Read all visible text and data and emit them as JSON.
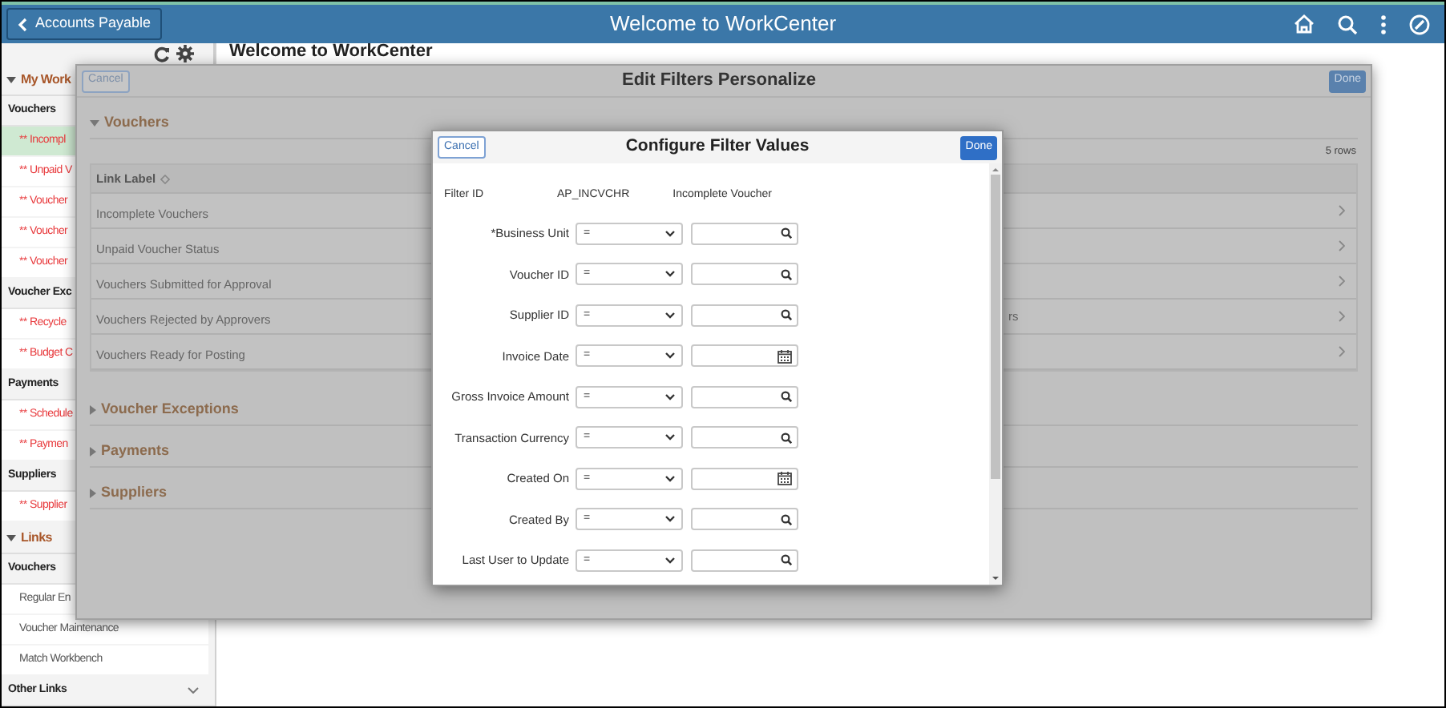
{
  "header": {
    "back_button": "Accounts Payable",
    "title": "Welcome to WorkCenter"
  },
  "sidebar": {
    "sections": [
      {
        "title": "My Work",
        "kind": "work",
        "expanded": true,
        "groups": [
          {
            "title": "Vouchers",
            "expanded": true,
            "items": [
              {
                "label": "** Incompl",
                "selected": true
              },
              {
                "label": "** Unpaid V",
                "selected": false
              },
              {
                "label": "** Voucher",
                "selected": false
              },
              {
                "label": "** Voucher",
                "selected": false
              },
              {
                "label": "** Voucher",
                "selected": false
              }
            ]
          },
          {
            "title": "Voucher Exc",
            "expanded": true,
            "items": [
              {
                "label": "** Recycle",
                "selected": false
              },
              {
                "label": "** Budget C",
                "selected": false
              }
            ]
          },
          {
            "title": "Payments",
            "expanded": true,
            "items": [
              {
                "label": "** Schedule",
                "selected": false
              },
              {
                "label": "** Paymen",
                "selected": false
              }
            ]
          },
          {
            "title": "Suppliers",
            "expanded": true,
            "items": [
              {
                "label": "** Supplier",
                "selected": false
              }
            ]
          }
        ]
      },
      {
        "title": "Links",
        "kind": "links",
        "expanded": true,
        "groups": [
          {
            "title": "Vouchers",
            "expanded": true,
            "items": [
              {
                "label": "Regular En",
                "selected": false
              },
              {
                "label": "Voucher Maintenance",
                "selected": false
              },
              {
                "label": "Match Workbench",
                "selected": false
              }
            ]
          },
          {
            "title": "Other Links",
            "expanded": false
          }
        ]
      }
    ]
  },
  "main": {
    "title": "Welcome to WorkCenter"
  },
  "edit_filters": {
    "title": "Edit Filters Personalize",
    "cancel": "Cancel",
    "done": "Done",
    "sections": [
      {
        "title": "Vouchers",
        "expanded": true,
        "row_count": "5 rows",
        "column_header": "Link Label",
        "rows": [
          {
            "label": "Incomplete Vouchers"
          },
          {
            "label": "Unpaid Voucher Status"
          },
          {
            "label": "Vouchers Submitted for Approval"
          },
          {
            "label": "Vouchers Rejected by Approvers",
            "column_2": "rs"
          },
          {
            "label": "Vouchers Ready for Posting"
          }
        ]
      },
      {
        "title": "Voucher Exceptions",
        "expanded": false
      },
      {
        "title": "Payments",
        "expanded": false
      },
      {
        "title": "Suppliers",
        "expanded": false
      }
    ]
  },
  "configure_filter": {
    "title": "Configure Filter Values",
    "cancel": "Cancel",
    "done": "Done",
    "filter_id": {
      "label": "Filter ID",
      "id": "AP_INCVCHR",
      "description": "Incomplete Voucher"
    },
    "fields": [
      {
        "label": "*Business Unit",
        "operator": "=",
        "kind": "prompt"
      },
      {
        "label": "Voucher ID",
        "operator": "=",
        "kind": "prompt"
      },
      {
        "label": "Supplier ID",
        "operator": "=",
        "kind": "prompt"
      },
      {
        "label": "Invoice Date",
        "operator": "=",
        "kind": "date"
      },
      {
        "label": "Gross Invoice Amount",
        "operator": "=",
        "kind": "prompt"
      },
      {
        "label": "Transaction Currency",
        "operator": "=",
        "kind": "prompt"
      },
      {
        "label": "Created On",
        "operator": "=",
        "kind": "date"
      },
      {
        "label": "Created By",
        "operator": "=",
        "kind": "prompt"
      },
      {
        "label": "Last User to Update",
        "operator": "=",
        "kind": "prompt"
      }
    ]
  }
}
